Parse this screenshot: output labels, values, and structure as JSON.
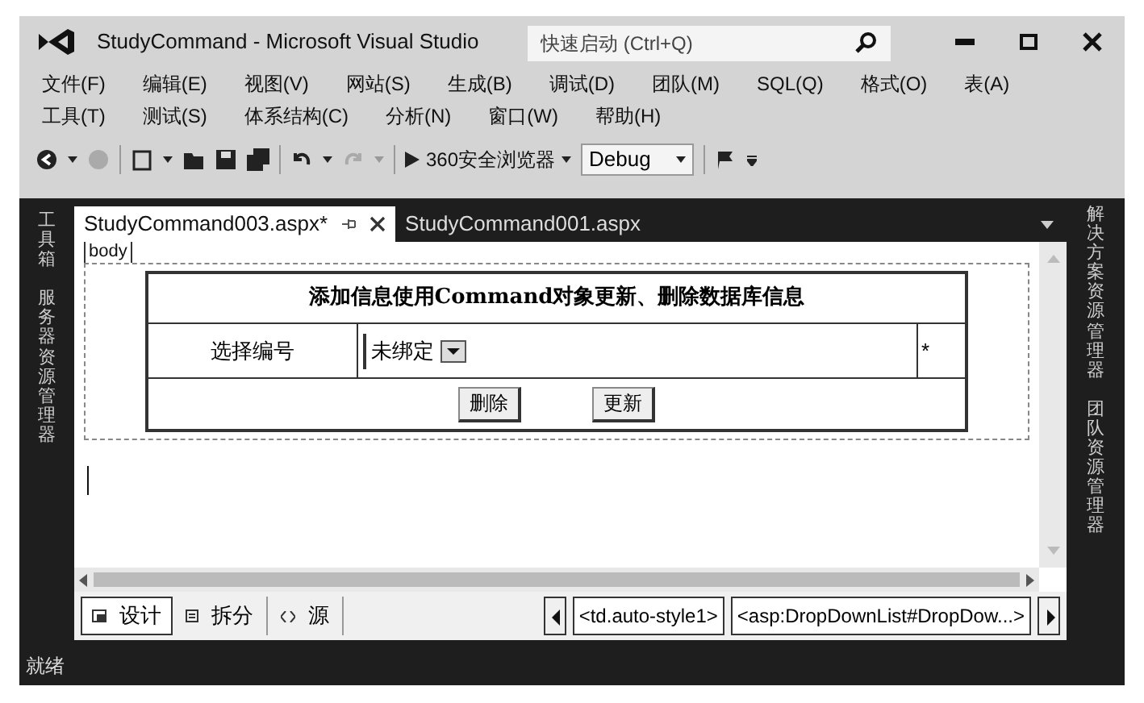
{
  "window": {
    "title": "StudyCommand - Microsoft Visual Studio",
    "quick_launch": {
      "placeholder": "快速启动 (Ctrl+Q)"
    }
  },
  "menu_rows": [
    [
      "文件(F)",
      "编辑(E)",
      "视图(V)",
      "网站(S)",
      "生成(B)",
      "调试(D)",
      "团队(M)",
      "SQL(Q)",
      "格式(O)",
      "表(A)"
    ],
    [
      "工具(T)",
      "测试(S)",
      "体系结构(C)",
      "分析(N)",
      "窗口(W)",
      "帮助(H)"
    ]
  ],
  "toolbar": {
    "browser": "360安全浏览器",
    "configuration": "Debug"
  },
  "left_panels": [
    "工具箱",
    "服务器资源管理器"
  ],
  "right_panels": [
    "解决方案资源管理器",
    "团队资源管理器"
  ],
  "tabs": [
    {
      "label": "StudyCommand003.aspx*",
      "selected": true
    },
    {
      "label": "StudyCommand001.aspx",
      "selected": false
    }
  ],
  "designer": {
    "tag": "body",
    "form": {
      "title": "添加信息使用Command对象更新、删除数据库信息",
      "label": "选择编号",
      "dropdown": "未绑定",
      "required_mark": "*",
      "buttons": [
        "删除",
        "更新"
      ]
    }
  },
  "view_tabs": [
    {
      "label": "设计",
      "selected": true
    },
    {
      "label": "拆分",
      "selected": false
    },
    {
      "label": "源",
      "selected": false
    }
  ],
  "tag_path": [
    "<td.auto-style1>",
    "<asp:DropDownList#DropDow...>"
  ],
  "status_bar": "就绪"
}
